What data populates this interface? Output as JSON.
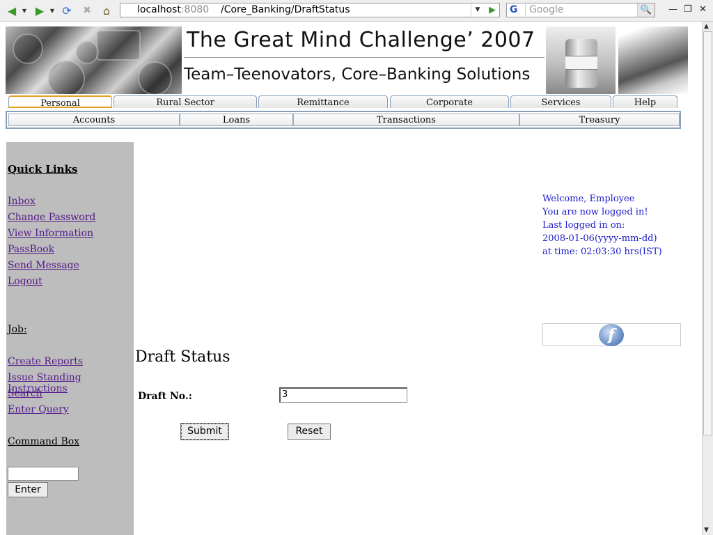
{
  "browser": {
    "url_host": "localhost",
    "url_port": ":8080",
    "url_path": "/Core_Banking/DraftStatus",
    "search_engine": "G",
    "search_placeholder": "Google"
  },
  "header": {
    "title": "The Great Mind Challenge’ 2007",
    "subtitle": "Team–Teenovators, Core–Banking Solutions"
  },
  "tabs": [
    "Personal",
    "Rural Sector",
    "Remittance",
    "Corporate",
    "Services",
    "Help"
  ],
  "subnav": [
    "Accounts",
    "Loans",
    "Transactions",
    "Treasury"
  ],
  "sidebar": {
    "quick_links_heading": "Quick Links",
    "quick_links": [
      "Inbox",
      "Change Password",
      "View Information",
      "PassBook",
      "Send Message",
      "Logout"
    ],
    "job_heading": "Job:",
    "job_links": [
      "Create Reports",
      "Issue Standing Instructions",
      "Search",
      "Enter Query"
    ],
    "command_heading": "Command Box",
    "enter_label": "Enter"
  },
  "welcome": {
    "line1": "Welcome, Employee",
    "line2": "You are now logged in!",
    "line3": "Last logged in on:",
    "line4": "2008-01-06(yyyy-mm-dd)",
    "line5": "at time: 02:03:30 hrs(IST)"
  },
  "form": {
    "title": "Draft Status",
    "draft_label": "Draft No.:",
    "draft_value": "3",
    "submit_label": "Submit",
    "reset_label": "Reset"
  }
}
